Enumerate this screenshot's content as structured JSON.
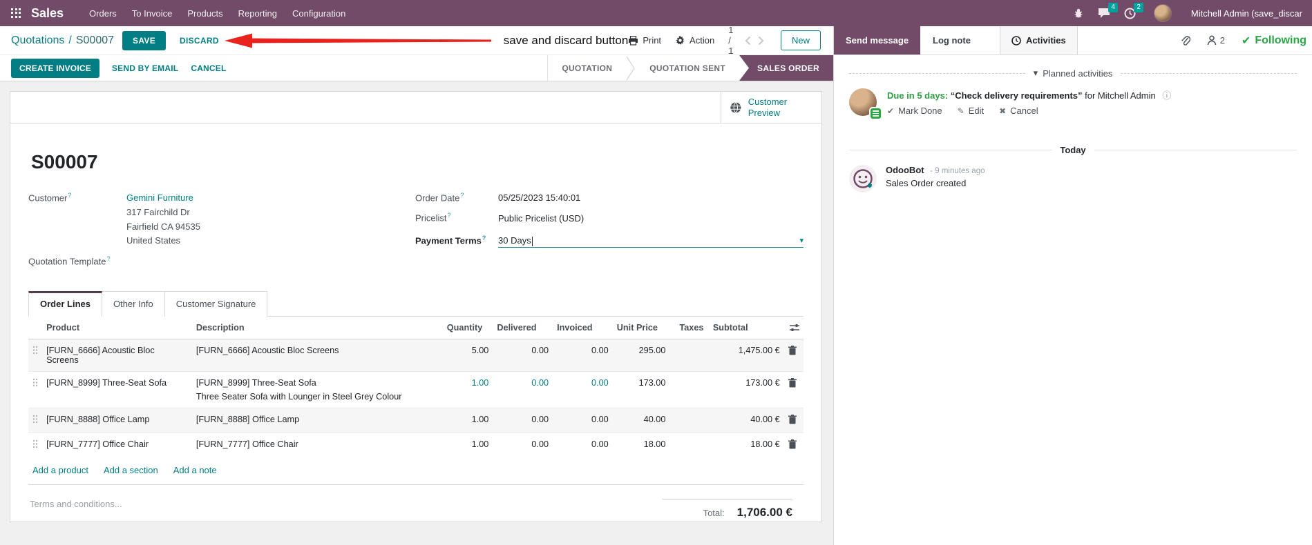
{
  "nav": {
    "app": "Sales",
    "items": [
      "Orders",
      "To Invoice",
      "Products",
      "Reporting",
      "Configuration"
    ],
    "messages_badge": "4",
    "activities_badge": "2",
    "user": "Mitchell Admin (save_discar"
  },
  "breadcrumb": {
    "parent": "Quotations",
    "separator": "/",
    "current": "S00007",
    "save": "SAVE",
    "discard": "DISCARD"
  },
  "annotation": {
    "text": "save and discard button"
  },
  "controlbar": {
    "print": "Print",
    "action": "Action",
    "pager": "1 / 1",
    "new": "New"
  },
  "actionbar": {
    "create_invoice": "CREATE INVOICE",
    "send_by_email": "SEND BY EMAIL",
    "cancel": "CANCEL"
  },
  "statusbar": {
    "stages": [
      "QUOTATION",
      "QUOTATION SENT",
      "SALES ORDER"
    ],
    "active": "SALES ORDER"
  },
  "sheet": {
    "preview_button": "Customer Preview",
    "title": "S00007",
    "help_marker": "?",
    "customer_label": "Customer",
    "customer_name": "Gemini Furniture",
    "customer_address": [
      "317 Fairchild Dr",
      "Fairfield CA 94535",
      "United States"
    ],
    "quotation_template_label": "Quotation Template",
    "order_date_label": "Order Date",
    "order_date": "05/25/2023 15:40:01",
    "pricelist_label": "Pricelist",
    "pricelist": "Public Pricelist (USD)",
    "payment_terms_label": "Payment Terms",
    "payment_terms": "30 Days"
  },
  "tabs": [
    "Order Lines",
    "Other Info",
    "Customer Signature"
  ],
  "order_lines": {
    "columns": [
      "Product",
      "Description",
      "Quantity",
      "Delivered",
      "Invoiced",
      "Unit Price",
      "Taxes",
      "Subtotal"
    ],
    "rows": [
      {
        "product": "[FURN_6666] Acoustic Bloc Screens",
        "description": "[FURN_6666] Acoustic Bloc Screens",
        "quantity": "5.00",
        "delivered": "0.00",
        "invoiced": "0.00",
        "unit_price": "295.00",
        "taxes": "",
        "subtotal": "1,475.00 €"
      },
      {
        "product": "[FURN_8999] Three-Seat Sofa",
        "description": "[FURN_8999] Three-Seat Sofa",
        "description2": "Three Seater Sofa with Lounger in Steel Grey Colour",
        "quantity": "1.00",
        "delivered": "0.00",
        "invoiced": "0.00",
        "unit_price": "173.00",
        "taxes": "",
        "subtotal": "173.00 €"
      },
      {
        "product": "[FURN_8888] Office Lamp",
        "description": "[FURN_8888] Office Lamp",
        "quantity": "1.00",
        "delivered": "0.00",
        "invoiced": "0.00",
        "unit_price": "40.00",
        "taxes": "",
        "subtotal": "40.00 €"
      },
      {
        "product": "[FURN_7777] Office Chair",
        "description": "[FURN_7777] Office Chair",
        "quantity": "1.00",
        "delivered": "0.00",
        "invoiced": "0.00",
        "unit_price": "18.00",
        "taxes": "",
        "subtotal": "18.00 €"
      }
    ],
    "footer_links": [
      "Add a product",
      "Add a section",
      "Add a note"
    ],
    "terms_placeholder": "Terms and conditions...",
    "total_label": "Total:",
    "total_value": "1,706.00 €"
  },
  "chatter": {
    "send_message": "Send message",
    "log_note": "Log note",
    "activities": "Activities",
    "followers_count": "2",
    "following": "Following",
    "planned_title": "Planned activities",
    "activity": {
      "due": "Due in 5 days:",
      "summary": "“Check delivery requirements”",
      "for_text": "for Mitchell Admin",
      "mark_done": "Mark Done",
      "edit": "Edit",
      "cancel": "Cancel"
    },
    "today": "Today",
    "message": {
      "author": "OdooBot",
      "time": "- 9 minutes ago",
      "body": "Sales Order created"
    }
  },
  "icons": {
    "caret_down": "▾",
    "check": "✔",
    "pencil": "✎",
    "cross": "✖",
    "info": "ⓘ"
  },
  "colors": {
    "primary": "#017E84",
    "brand": "#714B67",
    "success": "#28a745",
    "arrow": "#e8231d"
  }
}
